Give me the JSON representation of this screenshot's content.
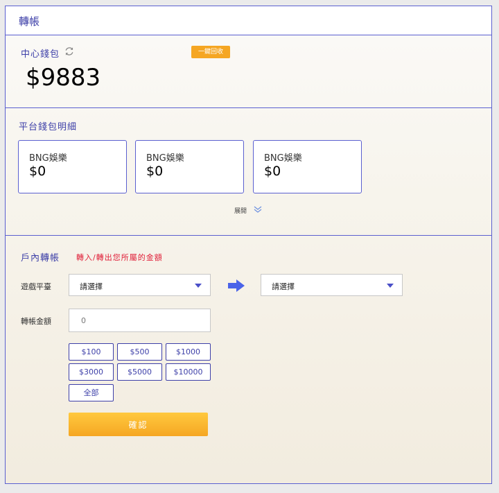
{
  "header": {
    "title": "轉帳"
  },
  "central_wallet": {
    "label": "中心錢包",
    "reclaim_button": "一鍵回收",
    "balance": "$9883"
  },
  "platform": {
    "title": "平台錢包明細",
    "cards": [
      {
        "name": "BNG娛樂",
        "amount": "$0"
      },
      {
        "name": "BNG娛樂",
        "amount": "$0"
      },
      {
        "name": "BNG娛樂",
        "amount": "$0"
      }
    ],
    "expand_label": "展開"
  },
  "transfer": {
    "title": "戶內轉帳",
    "note": "轉入/轉出您所屬的金額",
    "game_platform_label": "遊戲平臺",
    "from_select": "請選擇",
    "to_select": "請選擇",
    "amount_label": "轉帳金額",
    "amount_placeholder": "0",
    "quick_amounts": [
      "$100",
      "$500",
      "$1000",
      "$3000",
      "$5000",
      "$10000",
      "全部"
    ],
    "confirm_button": "確認"
  },
  "colors": {
    "accent": "#3d3fa8",
    "border": "#5a5fd0",
    "orange": "#f5a623",
    "note_red": "#e0203a"
  },
  "icons": [
    "refresh-icon",
    "chevron-double-down-icon",
    "arrow-right-icon",
    "caret-down-icon"
  ]
}
